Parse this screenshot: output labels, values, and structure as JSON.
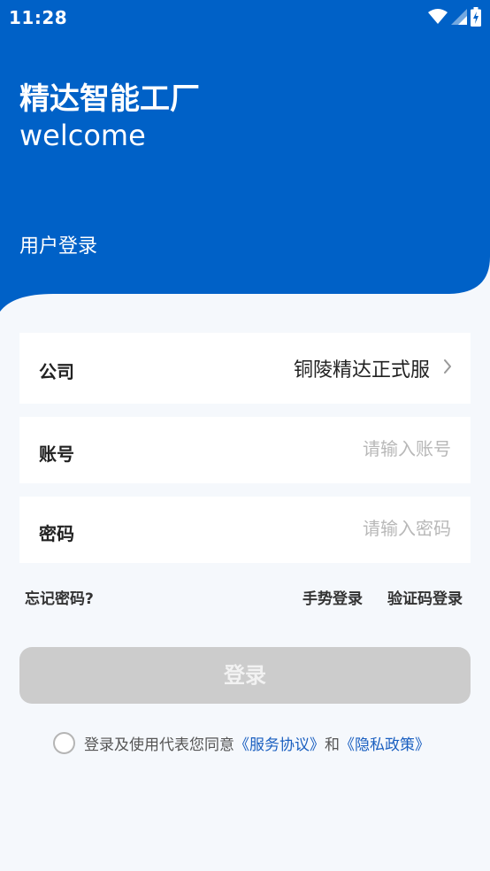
{
  "status_bar": {
    "time": "11:28"
  },
  "header": {
    "title": "精达智能工厂",
    "subtitle": "welcome",
    "login_type": "用户登录",
    "background_color": "#0061c7"
  },
  "form": {
    "company": {
      "label": "公司",
      "value": "铜陵精达正式服"
    },
    "account": {
      "label": "账号",
      "placeholder": "请输入账号"
    },
    "password": {
      "label": "密码",
      "placeholder": "请输入密码"
    }
  },
  "links": {
    "forgot_password": "忘记密码?",
    "gesture_login": "手势登录",
    "sms_login": "验证码登录"
  },
  "login_button": {
    "label": "登录",
    "color": "#cccccc"
  },
  "agreement": {
    "prefix": "登录及使用代表您同意",
    "service": "《服务协议》",
    "and": "和",
    "privacy": "《隐私政策》",
    "checked": false,
    "link_color": "#1a5fc0"
  },
  "icons": [
    "wifi-icon",
    "signal-icon",
    "battery-icon",
    "chevron-right-icon"
  ]
}
